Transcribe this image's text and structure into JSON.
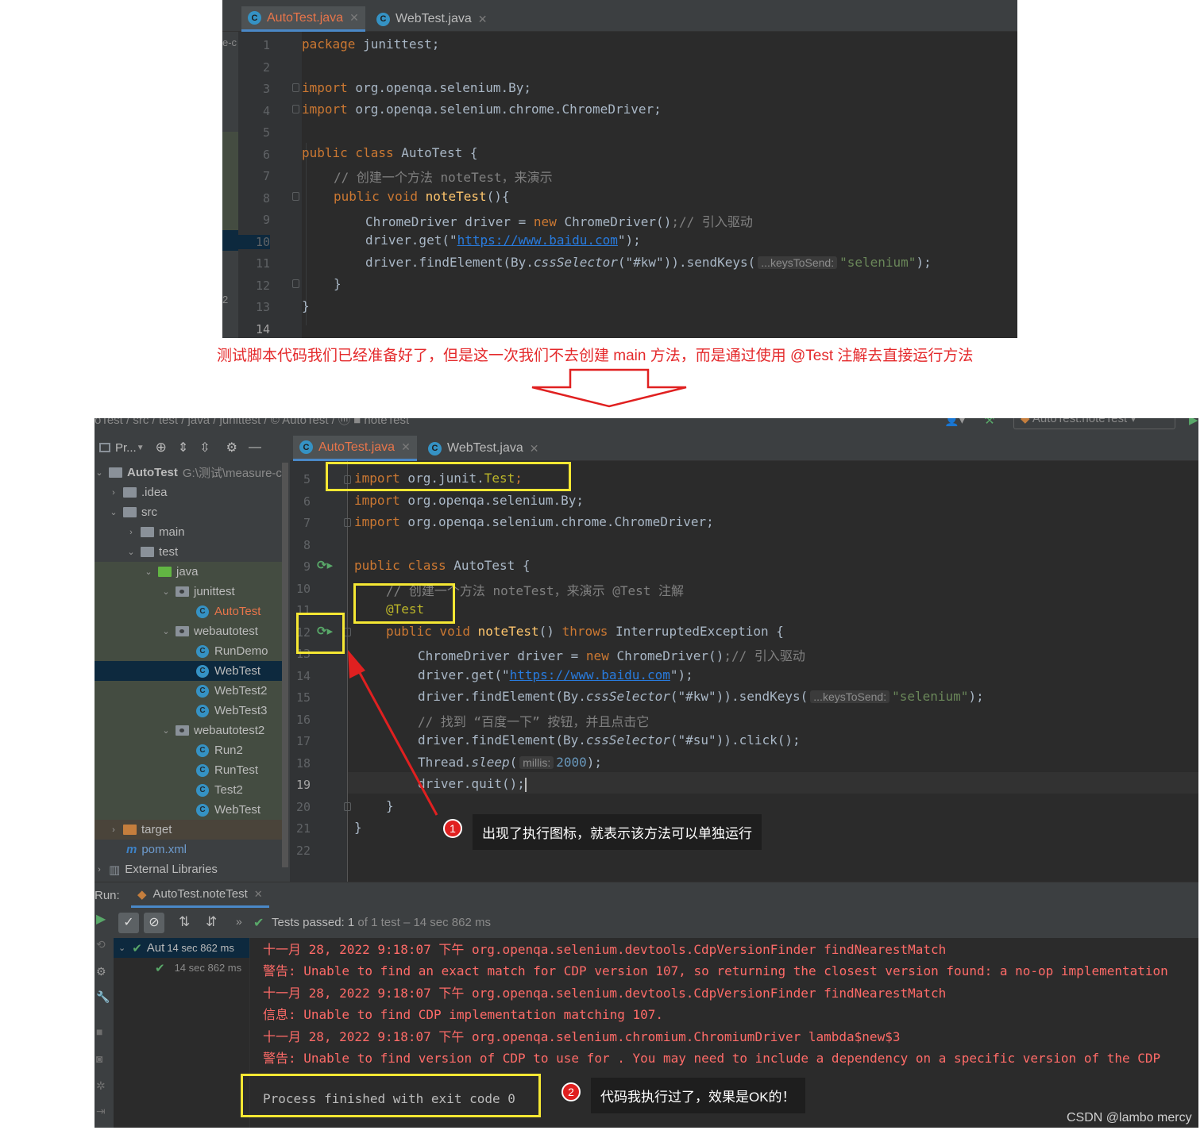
{
  "top_editor": {
    "tabs": [
      {
        "label": "AutoTest.java",
        "active": true
      },
      {
        "label": "WebTest.java",
        "active": false
      }
    ],
    "left_fragment": "e-c",
    "left_fragment2": "2",
    "line_numbers": [
      "1",
      "2",
      "3",
      "4",
      "5",
      "6",
      "7",
      "8",
      "9",
      "10",
      "11",
      "12",
      "13",
      "14"
    ],
    "code": {
      "l1_kw": "package",
      "l1_rest": " junittest;",
      "l3_kw": "import",
      "l3_rest": " org.openqa.selenium.By;",
      "l4_kw": "import",
      "l4_rest": " org.openqa.selenium.chrome.ChromeDriver;",
      "l6_kw": "public class",
      "l6_rest": " AutoTest {",
      "l7_comment": "// 创建一个方法 noteTest，来演示",
      "l8_kw": "public void",
      "l8_fn": " noteTest",
      "l8_rest": "(){",
      "l9_a": "ChromeDriver driver = ",
      "l9_kw": "new",
      "l9_b": " ChromeDriver()",
      "l9_c": ";// 引入驱动",
      "l10_a": "driver.get(\"",
      "l10_url": "https://www.baidu.com",
      "l10_b": "\");",
      "l11_a": "driver.findElement(By.",
      "l11_it": "cssSelector",
      "l11_b": "(\"#kw\")).sendKeys(",
      "l11_hint": "...keysToSend:",
      "l11_str": "\"selenium\"",
      "l11_c": ");",
      "l12": "}",
      "l13": "}"
    }
  },
  "caption": "测试脚本代码我们已经准备好了，但是这一次我们不去创建 main 方法，而是通过使用 @Test 注解去直接运行方法",
  "ide": {
    "breadcrumb": "oTest / src / test / java / junittest / © AutoTest / ⓜ ■ noteTest",
    "run_config": "AutoTest.noteTest",
    "project_panel": {
      "title": "Pr...",
      "tree": [
        {
          "label": "AutoTest",
          "extra": "G:\\测试\\measure-c"
        },
        {
          "label": ".idea"
        },
        {
          "label": "src"
        },
        {
          "label": "main"
        },
        {
          "label": "test"
        },
        {
          "label": "java"
        },
        {
          "label": "junittest"
        },
        {
          "label": "AutoTest"
        },
        {
          "label": "webautotest"
        },
        {
          "label": "RunDemo"
        },
        {
          "label": "WebTest"
        },
        {
          "label": "WebTest2"
        },
        {
          "label": "WebTest3"
        },
        {
          "label": "webautotest2"
        },
        {
          "label": "Run2"
        },
        {
          "label": "RunTest"
        },
        {
          "label": "Test2"
        },
        {
          "label": "WebTest"
        },
        {
          "label": "target"
        },
        {
          "label": "pom.xml"
        },
        {
          "label": "External Libraries"
        }
      ]
    },
    "editor": {
      "tabs": [
        {
          "label": "AutoTest.java",
          "active": true
        },
        {
          "label": "WebTest.java",
          "active": false
        }
      ],
      "line_numbers": [
        "5",
        "6",
        "7",
        "8",
        "9",
        "10",
        "11",
        "12",
        "13",
        "14",
        "15",
        "16",
        "17",
        "18",
        "19",
        "20",
        "21",
        "22"
      ],
      "code": {
        "l5_kw": "import",
        "l5_a": " org.junit.",
        "l5_cls": "Test",
        "l5_b": ";",
        "l6_kw": "import",
        "l6_a": " org.openqa.selenium.By;",
        "l7_kw": "import",
        "l7_a": " org.openqa.selenium.chrome.ChromeDriver;",
        "l9_kw": "public class",
        "l9_a": " AutoTest {",
        "l10_comment": "// 创建一个方法 noteTest，来演示 @Test 注解",
        "l11_ann": "@Test",
        "l12_kw": "public void",
        "l12_fn": " noteTest",
        "l12_a": "() ",
        "l12_kw2": "throws",
        "l12_b": " InterruptedException {",
        "l13_a": "ChromeDriver driver = ",
        "l13_kw": "new",
        "l13_b": " ChromeDriver()",
        "l13_c": ";// 引入驱动",
        "l14_a": "driver.get(\"",
        "l14_url": "https://www.baidu.com",
        "l14_b": "\");",
        "l15_a": "driver.findElement(By.",
        "l15_it": "cssSelector",
        "l15_b": "(\"#kw\")).sendKeys(",
        "l15_hint": "...keysToSend:",
        "l15_str": "\"selenium\"",
        "l15_c": ");",
        "l16_comment": "// 找到 “百度一下” 按钮，并且点击它",
        "l17_a": "driver.findElement(By.",
        "l17_it": "cssSelector",
        "l17_b": "(\"#su\")).click();",
        "l18_a": "Thread.",
        "l18_it": "sleep",
        "l18_b": "(",
        "l18_hint": "millis:",
        "l18_num": "2000",
        "l18_c": ");",
        "l19": "driver.quit();",
        "l20": "}",
        "l21": "}"
      }
    },
    "run_panel": {
      "label": "Run:",
      "tab": "AutoTest.noteTest",
      "status_prefix": "Tests passed:",
      "status_count": "1",
      "status_rest": "of 1 test – 14 sec 862 ms",
      "tree_root": "Aut",
      "tree_root_time": "14 sec 862 ms",
      "tree_child_time": "14 sec 862 ms",
      "console": [
        "十一月 28, 2022 9:18:07 下午 org.openqa.selenium.devtools.CdpVersionFinder findNearestMatch",
        "警告: Unable to find an exact match for CDP version 107, so returning the closest version found: a no-op implementation",
        "十一月 28, 2022 9:18:07 下午 org.openqa.selenium.devtools.CdpVersionFinder findNearestMatch",
        "信息: Unable to find CDP implementation matching 107.",
        "十一月 28, 2022 9:18:07 下午 org.openqa.selenium.chromium.ChromiumDriver lambda$new$3",
        "警告: Unable to find version of CDP to use for . You may need to include a dependency on a specific version of the CDP"
      ],
      "exit_line": "Process finished with exit code 0"
    }
  },
  "annotations": {
    "callout1_num": "1",
    "callout1_text": "出现了执行图标，就表示该方法可以单独运行",
    "callout2_num": "2",
    "callout2_text": "代码我执行过了，效果是OK的！"
  },
  "watermark": "CSDN @lambo mercy",
  "colors": {
    "caption": "#e4292b",
    "highlight_box": "#f5e733",
    "arrow_red": "#e02020",
    "keyword": "#cc7832",
    "string": "#6a8759",
    "console_error": "#ff6b68"
  }
}
